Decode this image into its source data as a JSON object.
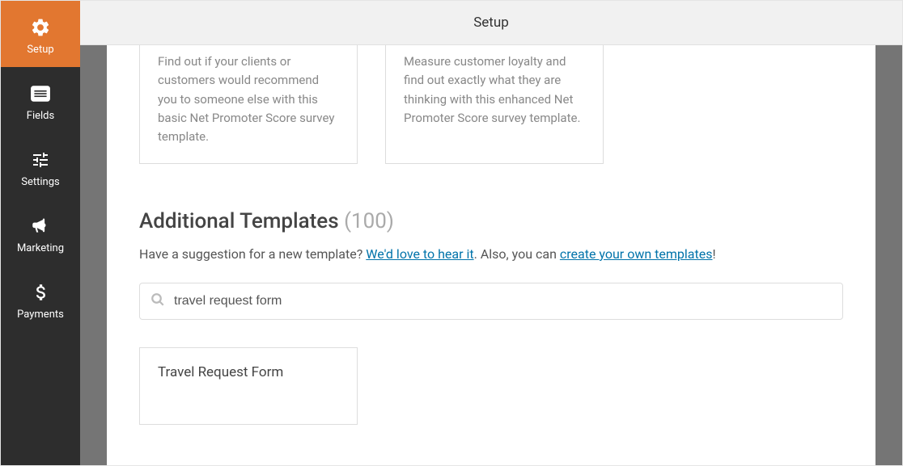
{
  "header": {
    "title": "Setup"
  },
  "sidebar": {
    "items": [
      {
        "label": "Setup"
      },
      {
        "label": "Fields"
      },
      {
        "label": "Settings"
      },
      {
        "label": "Marketing"
      },
      {
        "label": "Payments"
      }
    ]
  },
  "cards": [
    {
      "desc": "Find out if your clients or customers would recommend you to someone else with this basic Net Promoter Score survey template."
    },
    {
      "desc": "Measure customer loyalty and find out exactly what they are thinking with this enhanced Net Promoter Score survey template."
    }
  ],
  "section": {
    "title": "Additional Templates",
    "count": "(100)",
    "sub_prefix": "Have a suggestion for a new template? ",
    "link1": "We'd love to hear it",
    "sub_mid": ". Also, you can ",
    "link2": "create your own templates",
    "sub_suffix": "!"
  },
  "search": {
    "value": "travel request form"
  },
  "result": {
    "title": "Travel Request Form"
  }
}
